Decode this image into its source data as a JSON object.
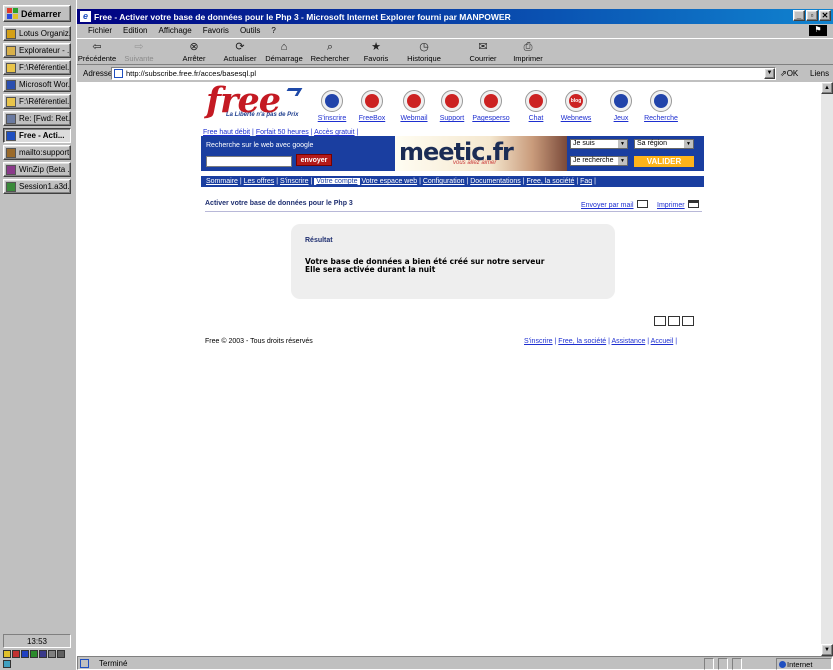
{
  "taskbar": {
    "start_label": "Démarrer",
    "items": [
      {
        "label": "Lotus Organiz...",
        "icon": "lotus-organizer-icon",
        "color": "#d4a017"
      },
      {
        "label": "Explorateur - ...",
        "icon": "explorer-icon",
        "color": "#d8b04a"
      },
      {
        "label": "F:\\Référentiel...",
        "icon": "folder-icon",
        "color": "#e8c44a"
      },
      {
        "label": "Microsoft Wor...",
        "icon": "word-icon",
        "color": "#2b4fb0"
      },
      {
        "label": "F:\\Référentiel...",
        "icon": "folder-icon",
        "color": "#e8c44a"
      },
      {
        "label": "Re: [Fwd: Ret...",
        "icon": "mail-icon",
        "color": "#6a7aa0"
      },
      {
        "label": "Free - Acti...",
        "icon": "ie-icon",
        "color": "#1f4fc0",
        "active": true
      },
      {
        "label": "mailto:support...",
        "icon": "mail-compose-icon",
        "color": "#9a6a2a"
      },
      {
        "label": "WinZip (Beta ...",
        "icon": "winzip-icon",
        "color": "#8a3a8a"
      },
      {
        "label": "Session1.a3d...",
        "icon": "session-icon",
        "color": "#3a8a3a"
      }
    ],
    "clock": "13:53"
  },
  "window": {
    "title": "Free - Activer votre base de données pour le Php 3 - Microsoft Internet Explorer fourni par MANPOWER",
    "menu": [
      "Fichier",
      "Edition",
      "Affichage",
      "Favoris",
      "Outils",
      "?"
    ],
    "toolbar": [
      {
        "label": "Précédente",
        "icon": "back-arrow-icon",
        "glyph": "⇦",
        "disabled": false
      },
      {
        "label": "Suivante",
        "icon": "forward-arrow-icon",
        "glyph": "⇨",
        "disabled": true
      },
      {
        "label": "Arrêter",
        "icon": "stop-icon",
        "glyph": "⊗",
        "disabled": false
      },
      {
        "label": "Actualiser",
        "icon": "refresh-icon",
        "glyph": "⟳",
        "disabled": false
      },
      {
        "label": "Démarrage",
        "icon": "home-icon",
        "glyph": "⌂",
        "disabled": false
      },
      {
        "label": "Rechercher",
        "icon": "search-icon",
        "glyph": "⌕",
        "disabled": false
      },
      {
        "label": "Favoris",
        "icon": "favorites-icon",
        "glyph": "★",
        "disabled": false
      },
      {
        "label": "Historique",
        "icon": "history-icon",
        "glyph": "◷",
        "disabled": false
      },
      {
        "label": "Courrier",
        "icon": "mail-icon",
        "glyph": "✉",
        "disabled": false
      },
      {
        "label": "Imprimer",
        "icon": "print-icon",
        "glyph": "⎙",
        "disabled": false
      }
    ],
    "address_label": "Adresse",
    "address": "http://subscribe.free.fr/acces/basesql.pl",
    "go_label": "OK",
    "links_label": "Liens »",
    "status": "Terminé",
    "zone": "Internet"
  },
  "page": {
    "logo_word": "free",
    "logo_tagline": "La Liberté n'a pas de Prix",
    "nav_icons": [
      {
        "label": "S'inscrire",
        "icon": "signup-icon",
        "color": "#2244aa"
      },
      {
        "label": "FreeBox",
        "icon": "freebox-icon",
        "color": "#cc2222"
      },
      {
        "label": "Webmail",
        "icon": "webmail-icon",
        "color": "#cc2222"
      },
      {
        "label": "Support",
        "icon": "support-icon",
        "color": "#cc2222"
      },
      {
        "label": "Pagesperso",
        "icon": "pagesperso-icon",
        "color": "#cc2222"
      },
      {
        "label": "Chat",
        "icon": "chat-icon",
        "color": "#cc2222"
      },
      {
        "label": "Webnews",
        "icon": "webnews-icon",
        "color": "#cc2222",
        "text": "blog"
      },
      {
        "label": "Jeux",
        "icon": "games-icon",
        "color": "#2244aa"
      },
      {
        "label": "Recherche",
        "icon": "search-icon",
        "color": "#2244aa"
      }
    ],
    "small_links": [
      "Free haut débit",
      "Forfait 50 heures",
      "Accès gratuit"
    ],
    "search_label": "Recherche sur le web avec google",
    "search_button": "envoyer",
    "meetic_brand": "meetic.fr",
    "meetic_tagline": "vous allez aimer",
    "meetic_select1": "Je suis",
    "meetic_select2": "Sa région",
    "meetic_select3": "Je recherche",
    "meetic_button": "VALIDER",
    "nav_links": [
      {
        "label": "Sommaire",
        "current": false
      },
      {
        "label": "Les offres",
        "current": false
      },
      {
        "label": "S'inscrire",
        "current": false
      },
      {
        "label": "Votre compte",
        "current": true
      },
      {
        "label": "Votre espace web",
        "current": false
      },
      {
        "label": "Configuration",
        "current": false
      },
      {
        "label": "Documentations",
        "current": false
      },
      {
        "label": "Free, la société",
        "current": false
      },
      {
        "label": "Faq",
        "current": false
      }
    ],
    "headline": "Activer votre base de données pour le Php 3",
    "send_mail": "Envoyer par mail",
    "print": "Imprimer",
    "result_title": "Résultat",
    "result_line1": "Votre base de données a bien été créé sur notre serveur",
    "result_line2": "Elle sera activée durant la nuit",
    "footer": "Free © 2003 - Tous droits réservés",
    "footer_links": [
      "S'inscrire",
      "Free, la société",
      "Assistance",
      "Accueil"
    ]
  }
}
